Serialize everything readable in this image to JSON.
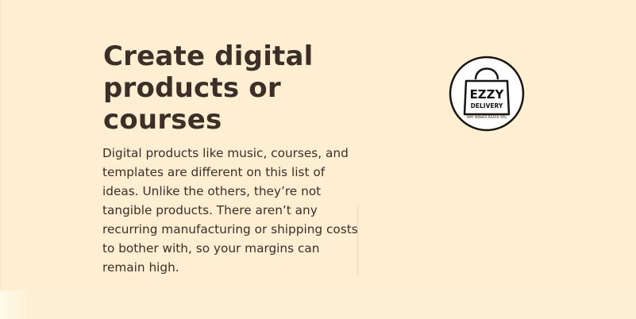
{
  "section": {
    "title": "Create digital products or courses",
    "body": "Digital products like music, courses, and templates are different on this list of ideas. Unlike the others, they’re not tangible products. There aren’t any recurring manufacturing or shipping costs to bother with, so your margins can remain high."
  },
  "logo": {
    "brand_top": "EZZY",
    "brand_bottom": "DELIVERY",
    "tagline": "WAY WISHES REACH YOU",
    "icon": "shopping-bag-icon"
  },
  "colors": {
    "background": "#feeed2",
    "text": "#3b2f28"
  }
}
